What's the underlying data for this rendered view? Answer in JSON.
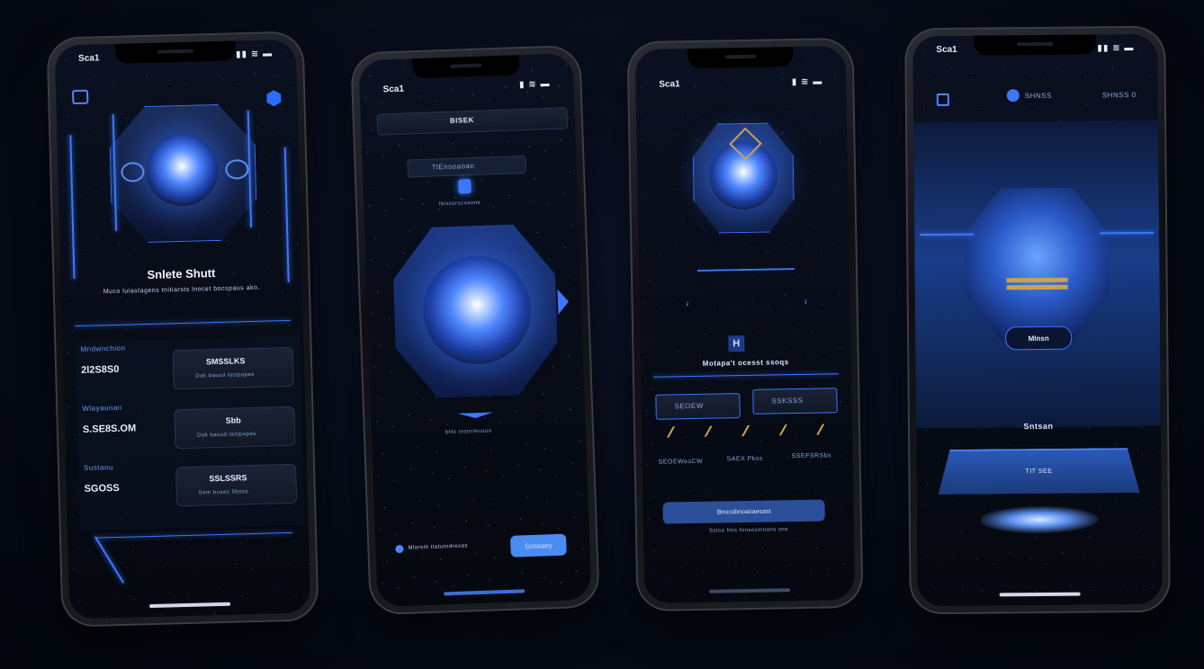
{
  "phones": [
    {
      "status_time": "Sca1",
      "title": "Snlete Shutt",
      "subtitle": "Muco luiastagens tnitiarsts lnocet bocspaus ako.",
      "stats": [
        {
          "header": "Mndwnchion",
          "value": "2l2S8S0",
          "card_title": "SMSSLKS",
          "card_sub": "Dak bausd lastpapes"
        },
        {
          "header": "Wlayaunan",
          "value": "S.SE8S.OM",
          "card_title": "Sbb",
          "card_sub": "Dak bausd lastpapes"
        },
        {
          "header": "Sustaou",
          "value": "SGOSS",
          "card_title": "SSLSSRS",
          "card_sub": "Sem buses fibsso"
        }
      ]
    },
    {
      "status_time": "Sca1",
      "header_label": "BISEK",
      "tab_label": "TlEnsoaoan",
      "chip_label": "lbisssrscsaons",
      "under_orb": "bHo tnsnrteusua",
      "footer_text": "Mlarsth ttatutndresas",
      "footer_button": "Sossaey"
    },
    {
      "status_time": "Sca1",
      "title": "Motapa't ocesst ssoqs",
      "tab_left": "SEOEW",
      "tab_right": "SSKSSS",
      "items": [
        "SEOEWesCW",
        "SAEX Pkss",
        "SSEFSRSbs"
      ],
      "button": "Bnocsbnoaoaesast",
      "caption": "Sstsa Nss fonsosmnans sne"
    },
    {
      "status_time": "Sca1",
      "nav_left": "SHNSS",
      "nav_right": "SHNSS 0",
      "banner_label": "Mlnsn",
      "section_label": "Sntsan",
      "card_label": "TIT SEE"
    }
  ]
}
